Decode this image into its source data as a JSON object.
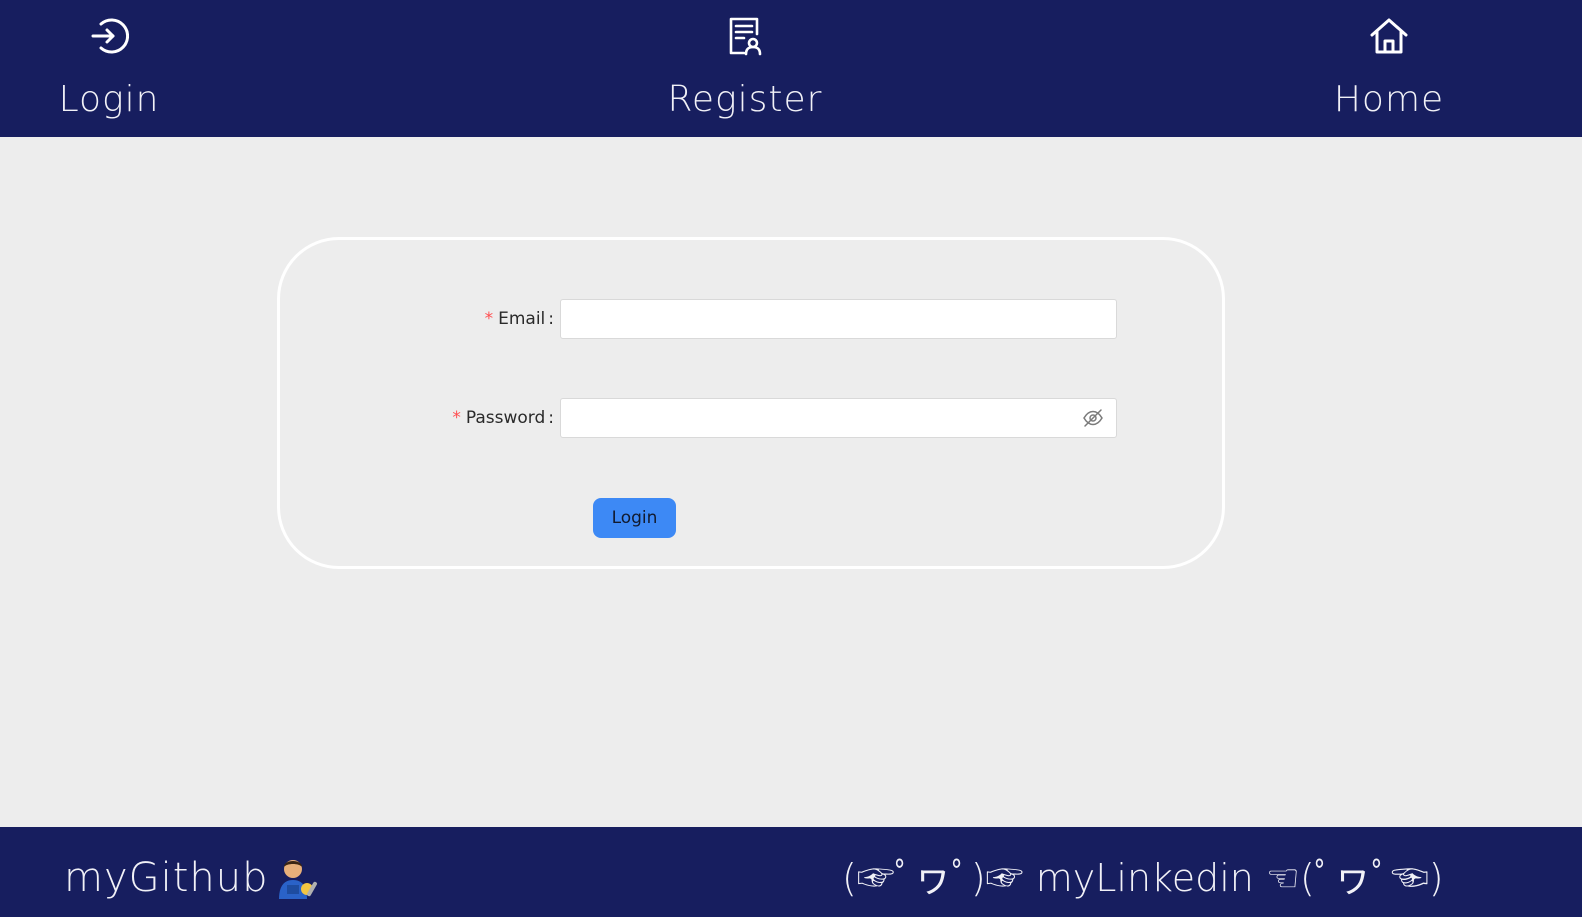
{
  "nav": {
    "login": {
      "label": "Login",
      "icon": "login-icon"
    },
    "register": {
      "label": "Register",
      "icon": "register-icon"
    },
    "home": {
      "label": "Home",
      "icon": "home-icon"
    }
  },
  "form": {
    "email": {
      "label": "Email",
      "required_mark": "*",
      "value": "",
      "placeholder": ""
    },
    "password": {
      "label": "Password",
      "required_mark": "*",
      "value": "",
      "placeholder": "",
      "toggle_icon": "eye-invisible-icon"
    },
    "submit_label": "Login"
  },
  "footer": {
    "github": {
      "label": "myGithub",
      "icon": "mechanic-emoji-icon"
    },
    "linkedin": {
      "label": "(☞ﾟヮﾟ)☞ myLinkedin ☜(ﾟヮﾟ☜)"
    }
  },
  "colors": {
    "header_bg": "#171e5f",
    "page_bg": "#ededed",
    "primary_button": "#3d89f5",
    "required": "#ff4d4f"
  }
}
